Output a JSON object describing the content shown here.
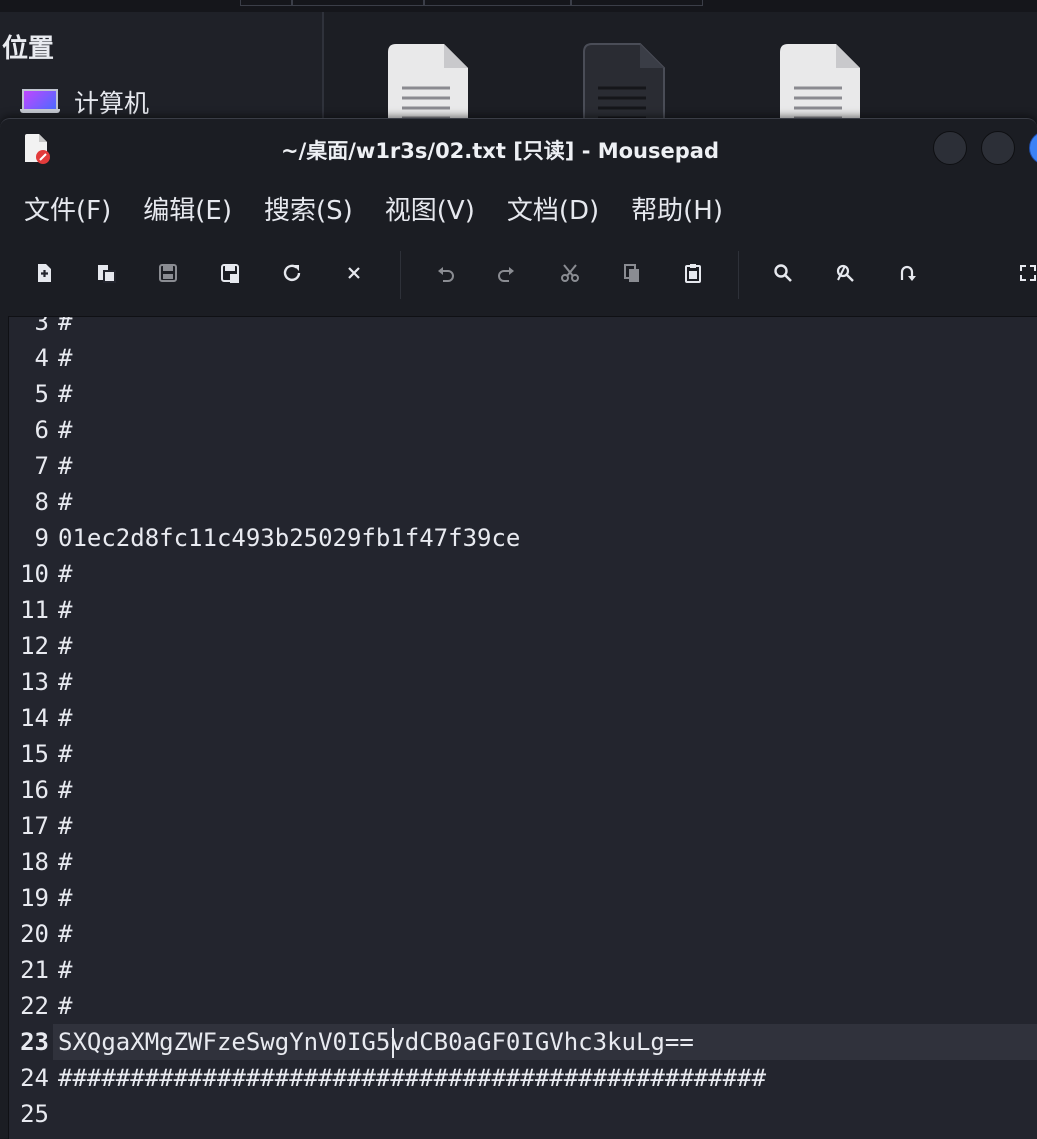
{
  "file_manager": {
    "places_title": "位置",
    "computer_label": "计算机"
  },
  "window": {
    "title": "~/桌面/w1r3s/02.txt [只读] - Mousepad"
  },
  "menu": [
    {
      "label": "文件(F)"
    },
    {
      "label": "编辑(E)"
    },
    {
      "label": "搜索(S)"
    },
    {
      "label": "视图(V)"
    },
    {
      "label": "文档(D)"
    },
    {
      "label": "帮助(H)"
    }
  ],
  "toolbar_icons": [
    "new-document-icon",
    "new-window-icon",
    "save-icon",
    "save-as-icon",
    "reload-icon",
    "close-document-icon",
    "undo-icon",
    "redo-icon",
    "cut-icon",
    "copy-icon",
    "paste-icon",
    "find-icon",
    "find-replace-icon",
    "go-to-line-icon",
    "fullscreen-icon"
  ],
  "editor": {
    "current_line": "23",
    "lines": [
      {
        "n": "3",
        "text": "#"
      },
      {
        "n": "4",
        "text": "#"
      },
      {
        "n": "5",
        "text": "#"
      },
      {
        "n": "6",
        "text": "#"
      },
      {
        "n": "7",
        "text": "#"
      },
      {
        "n": "8",
        "text": "#"
      },
      {
        "n": "9",
        "text": "01ec2d8fc11c493b25029fb1f47f39ce"
      },
      {
        "n": "10",
        "text": "#"
      },
      {
        "n": "11",
        "text": "#"
      },
      {
        "n": "12",
        "text": "#"
      },
      {
        "n": "13",
        "text": "#"
      },
      {
        "n": "14",
        "text": "#"
      },
      {
        "n": "15",
        "text": "#"
      },
      {
        "n": "16",
        "text": "#"
      },
      {
        "n": "17",
        "text": "#"
      },
      {
        "n": "18",
        "text": "#"
      },
      {
        "n": "19",
        "text": "#"
      },
      {
        "n": "20",
        "text": "#"
      },
      {
        "n": "21",
        "text": "#"
      },
      {
        "n": "22",
        "text": "#"
      },
      {
        "n": "23",
        "text": "SXQgaXMgZWFzeSwgYnV0IG5vdCB0aGF0IGVhc3kuLg=="
      },
      {
        "n": "24",
        "text": "#################################################"
      },
      {
        "n": "25",
        "text": ""
      }
    ]
  }
}
